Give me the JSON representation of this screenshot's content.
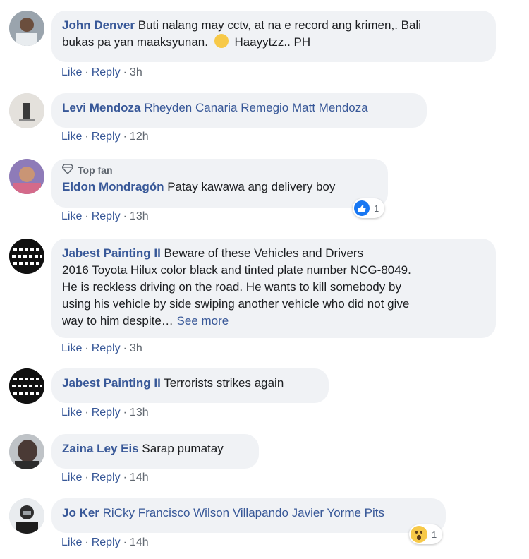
{
  "comments": [
    {
      "author": "John Denver",
      "text_line1": "Buti nalang may cctv, at na e record ang krimen,. Bali",
      "text_line2": "bukas pa yan maaksyunan.",
      "text_line2b": "Haayytzz.. PH",
      "actions": {
        "like": "Like",
        "reply": "Reply",
        "time": "3h"
      }
    },
    {
      "author": "Levi Mendoza",
      "mentions": "Rheyden Canaria Remegio Matt Mendoza",
      "actions": {
        "like": "Like",
        "reply": "Reply",
        "time": "12h"
      }
    },
    {
      "badge": "Top fan",
      "author": "Eldon Mondragón",
      "text": "Patay kawawa ang delivery boy",
      "reaction_count": "1",
      "reaction_icon": "like-icon",
      "actions": {
        "like": "Like",
        "reply": "Reply",
        "time": "13h"
      }
    },
    {
      "author": "Jabest Painting II",
      "text_line1": "Beware of these Vehicles and Drivers",
      "text_line2": "2016 Toyota Hilux color black and tinted plate number NCG-8049.",
      "text_line3": "He is reckless driving on the road. He wants to kill somebody by",
      "text_line4": "using his vehicle by side swiping another vehicle who did not give",
      "text_line5": "way to him despite…",
      "see_more": "See more",
      "actions": {
        "like": "Like",
        "reply": "Reply",
        "time": "3h"
      }
    },
    {
      "author": "Jabest Painting II",
      "text": "Terrorists strikes again",
      "actions": {
        "like": "Like",
        "reply": "Reply",
        "time": "13h"
      }
    },
    {
      "author": "Zaina Ley Eis",
      "text": "Sarap pumatay",
      "actions": {
        "like": "Like",
        "reply": "Reply",
        "time": "14h"
      }
    },
    {
      "author": "Jo Ker",
      "mentions": "RiCky Francisco Wilson Villapando Javier Yorme Pits",
      "reaction_count": "1",
      "reaction_icon": "wow-icon",
      "actions": {
        "like": "Like",
        "reply": "Reply",
        "time": "14h"
      }
    }
  ],
  "colors": {
    "link": "#385898",
    "bubble": "#f0f2f5",
    "meta": "#606770",
    "like_blue": "#1877f2"
  }
}
